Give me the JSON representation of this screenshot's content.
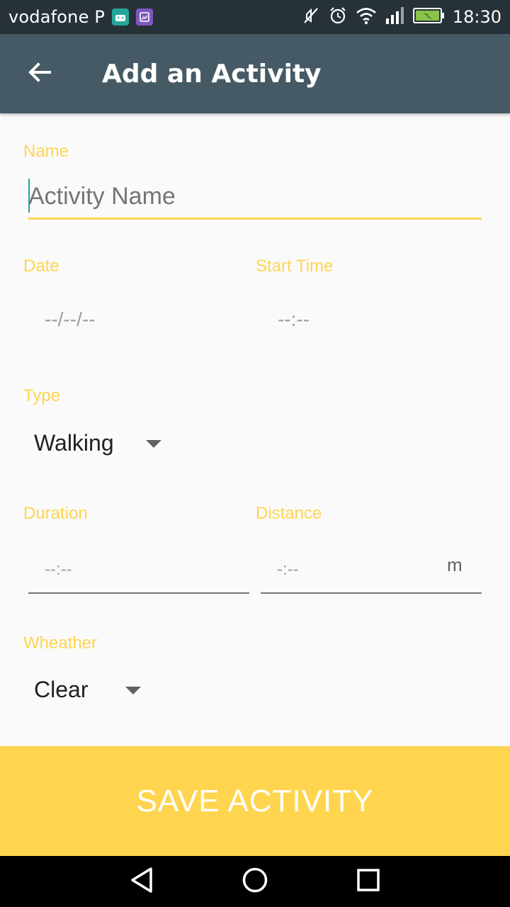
{
  "status_bar": {
    "carrier": "vodafone P",
    "time": "18:30",
    "icons": [
      "android-notification-icon",
      "image-notification-icon",
      "mute-icon",
      "alarm-icon",
      "wifi-icon",
      "signal-icon",
      "battery-charging-icon"
    ]
  },
  "app_bar": {
    "title": "Add an Activity",
    "back_icon": "arrow-back-icon"
  },
  "form": {
    "name": {
      "label": "Name",
      "placeholder": "Activity Name",
      "value": ""
    },
    "date": {
      "label": "Date",
      "value": "--/--/--"
    },
    "start_time": {
      "label": "Start Time",
      "value": "--:--"
    },
    "type": {
      "label": "Type",
      "selected": "Walking"
    },
    "duration": {
      "label": "Duration",
      "placeholder": "--:--"
    },
    "distance": {
      "label": "Distance",
      "placeholder": "-:--",
      "unit": "m"
    },
    "weather": {
      "label": "Wheather",
      "selected": "Clear"
    }
  },
  "save_button": {
    "label": "SAVE ACTIVITY"
  },
  "nav_bar": {
    "icons": [
      "back-triangle-icon",
      "home-circle-icon",
      "recents-square-icon"
    ]
  },
  "colors": {
    "status_bar": "#263238",
    "app_bar": "#455a64",
    "accent": "#ffd54f",
    "background": "#fafafa"
  }
}
